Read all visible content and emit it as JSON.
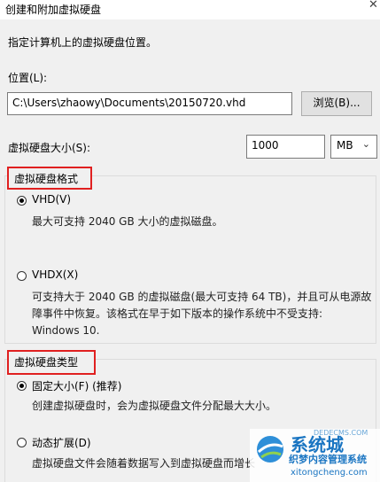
{
  "window": {
    "title": "创建和附加虚拟硬盘"
  },
  "intro": "指定计算机上的虚拟硬盘位置。",
  "location": {
    "label": "位置(L):",
    "value": "C:\\Users\\zhaowy\\Documents\\20150720.vhd",
    "browse_label": "浏览(B)..."
  },
  "size": {
    "label": "虚拟硬盘大小(S):",
    "value": "1000",
    "unit": "MB"
  },
  "format": {
    "heading": "虚拟硬盘格式",
    "options": [
      {
        "label": "VHD(V)",
        "selected": true,
        "desc": [
          "最大可支持 2040 GB 大小的虚拟磁盘。"
        ]
      },
      {
        "label": "VHDX(X)",
        "selected": false,
        "desc": [
          "可支持大于 2040 GB 的虚拟磁盘(最大可支持 64 TB)，并且可从电源故",
          "障事件中恢复。该格式在早于如下版本的操作系统中不受支持:",
          "Windows 10."
        ]
      }
    ]
  },
  "type": {
    "heading": "虚拟硬盘类型",
    "options": [
      {
        "label": "固定大小(F) (推荐)",
        "selected": true,
        "desc": [
          "创建虚拟硬盘时，会为虚拟硬盘文件分配最大大小。"
        ]
      },
      {
        "label": "动态扩展(D)",
        "selected": false,
        "desc": [
          "虚拟硬盘文件会随着数据写入到虚拟硬盘而增长"
        ]
      }
    ]
  },
  "watermark": {
    "brand": "系统城",
    "sub": "织梦内容管理系统",
    "domain": "DEDECMS.COM",
    "site": "xitongcheng.com"
  },
  "colors": {
    "highlight_border": "#e02020",
    "watermark_blue": "#1a75c2"
  }
}
